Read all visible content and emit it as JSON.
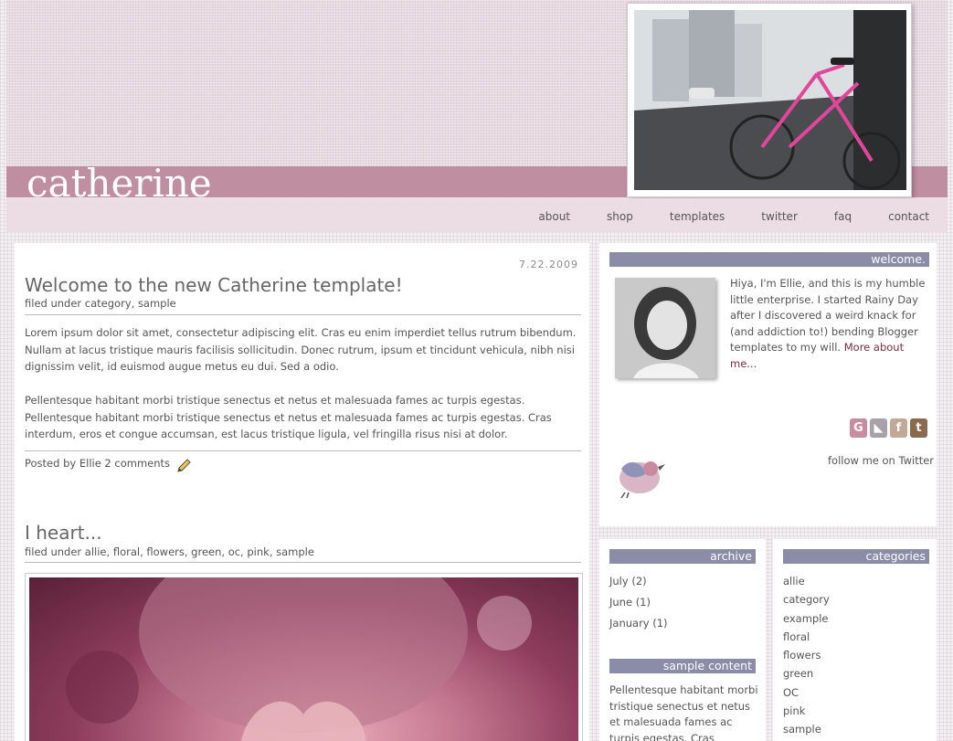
{
  "site": {
    "title": "catherine"
  },
  "nav": [
    "about",
    "shop",
    "templates",
    "twitter",
    "faq",
    "contact"
  ],
  "posts": [
    {
      "date": "7.22.2009",
      "title": "Welcome to the new Catherine template!",
      "filed": "filed under category, sample",
      "paragraphs": [
        "Lorem ipsum dolor sit amet, consectetur adipiscing elit. Cras eu enim imperdiet tellus rutrum bibendum. Nullam at lacus tristique mauris facilisis sollicitudin. Donec rutrum, ipsum et tincidunt vehicula, nibh nisi dignissim velit, id euismod augue metus eu dui. Sed a odio.",
        "Pellentesque habitant morbi tristique senectus et netus et malesuada fames ac turpis egestas. Pellentesque habitant morbi tristique senectus et netus et malesuada fames ac turpis egestas. Cras interdum, eros et congue accumsan, est lacus tristique ligula, vel fringilla risus nisi at dolor."
      ],
      "footer": "Posted by Ellie 2 comments"
    },
    {
      "title": "I heart...",
      "filed": "filed under allie, floral, flowers, green, oc, pink, sample"
    }
  ],
  "sidebar": {
    "welcome_heading": "welcome.",
    "welcome_text": "Hiya, I'm Ellie, and this is my humble little enterprise. I started Rainy Day after I discovered a weird knack for (and addiction to!) bending Blogger templates to my will.",
    "welcome_link": "More about me...",
    "social_icons": [
      "google-icon",
      "rss-icon",
      "facebook-icon",
      "twitter-icon"
    ],
    "social_glyphs": [
      "G",
      "◣",
      "f",
      "t"
    ],
    "follow_text": "follow me on Twitter",
    "archive_heading": "archive",
    "archive": [
      "July (2)",
      "June (1)",
      "January (1)"
    ],
    "sample_heading": "sample content",
    "sample_text": "Pellentesque habitant morbi tristique senectus et netus et malesuada fames ac turpis egestas. Cras interdum, eros",
    "categories_heading": "categories",
    "categories": [
      "allie",
      "category",
      "example",
      "floral",
      "flowers",
      "green",
      "OC",
      "pink",
      "sample"
    ]
  },
  "colors": {
    "accent": "#c08ea1",
    "sidebar_heading": "#8a8ca8",
    "link": "#7a2f3e"
  }
}
